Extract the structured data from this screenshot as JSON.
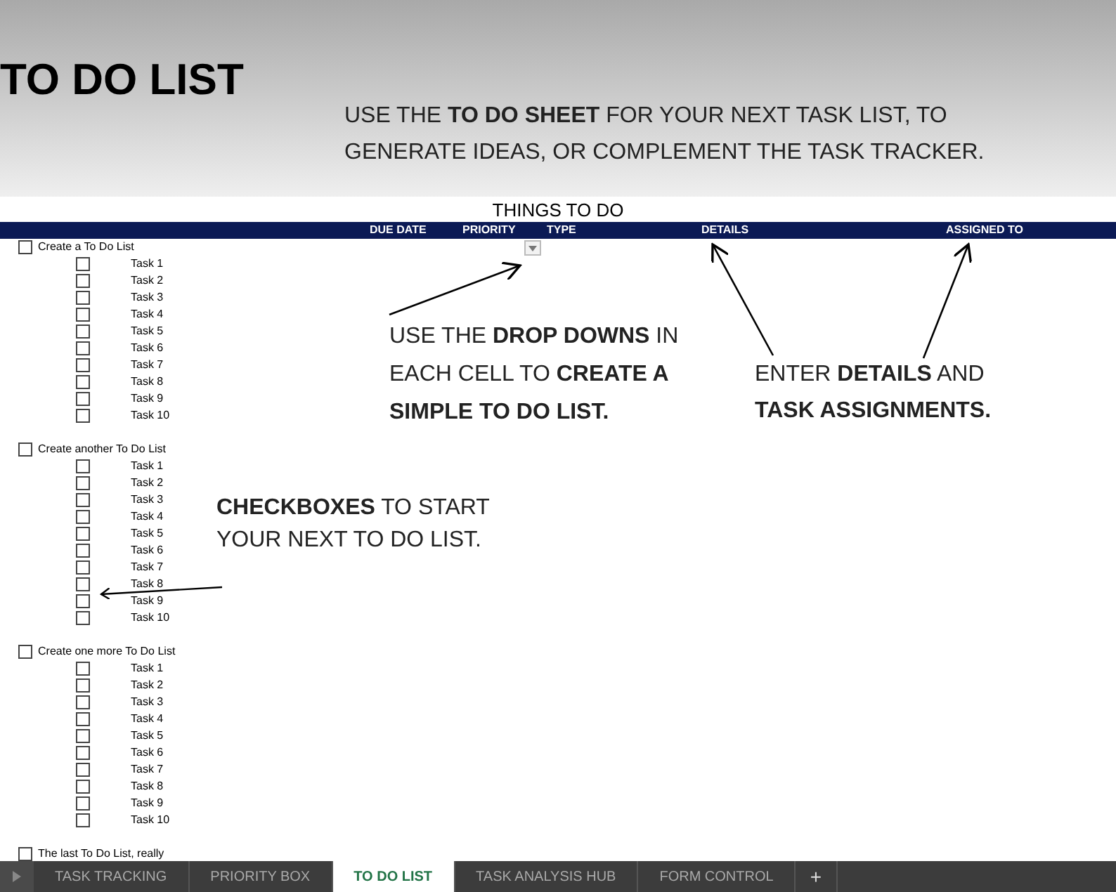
{
  "title": "TO DO LIST",
  "intro": [
    "USE THE **TO DO SHEET** FOR YOUR NEXT TASK LIST, TO",
    "GENERATE IDEAS, OR COMPLEMENT THE TASK TRACKER."
  ],
  "sheet": {
    "heading": "THINGS TO DO",
    "columns": [
      "DUE DATE",
      "PRIORITY",
      "TYPE",
      "DETAILS",
      "ASSIGNED TO"
    ],
    "lists": [
      {
        "label": "Create a To Do List",
        "checked": false,
        "tasks": [
          {
            "label": "Task 1",
            "checked": false
          },
          {
            "label": "Task 2",
            "checked": false
          },
          {
            "label": "Task 3",
            "checked": false
          },
          {
            "label": "Task 4",
            "checked": false
          },
          {
            "label": "Task 5",
            "checked": false
          },
          {
            "label": "Task 6",
            "checked": false
          },
          {
            "label": "Task 7",
            "checked": false
          },
          {
            "label": "Task 8",
            "checked": false
          },
          {
            "label": "Task 9",
            "checked": false
          },
          {
            "label": "Task 10",
            "checked": false
          }
        ]
      },
      {
        "label": "Create another To Do List",
        "checked": false,
        "tasks": [
          {
            "label": "Task 1",
            "checked": false
          },
          {
            "label": "Task 2",
            "checked": false
          },
          {
            "label": "Task 3",
            "checked": false
          },
          {
            "label": "Task 4",
            "checked": false
          },
          {
            "label": "Task 5",
            "checked": false
          },
          {
            "label": "Task 6",
            "checked": false
          },
          {
            "label": "Task 7",
            "checked": false
          },
          {
            "label": "Task 8",
            "checked": false
          },
          {
            "label": "Task 9",
            "checked": false
          },
          {
            "label": "Task 10",
            "checked": false
          }
        ]
      },
      {
        "label": "Create one more To Do List",
        "checked": false,
        "tasks": [
          {
            "label": "Task 1",
            "checked": false
          },
          {
            "label": "Task 2",
            "checked": false
          },
          {
            "label": "Task 3",
            "checked": false
          },
          {
            "label": "Task 4",
            "checked": false
          },
          {
            "label": "Task 5",
            "checked": false
          },
          {
            "label": "Task 6",
            "checked": false
          },
          {
            "label": "Task 7",
            "checked": false
          },
          {
            "label": "Task 8",
            "checked": false
          },
          {
            "label": "Task 9",
            "checked": false
          },
          {
            "label": "Task 10",
            "checked": false
          }
        ]
      },
      {
        "label": "The last To Do List, really",
        "checked": false
      }
    ]
  },
  "callouts": [
    {
      "lines": [
        "USE THE **DROP DOWNS** IN",
        "EACH CELL TO **CREATE A**",
        "**SIMPLE TO DO LIST.**"
      ]
    },
    {
      "lines": [
        "ENTER **DETAILS** AND",
        "**TASK ASSIGNMENTS.**"
      ]
    },
    {
      "lines": [
        "**CHECKBOXES** TO START",
        "YOUR NEXT TO DO LIST."
      ]
    }
  ],
  "sheet_tabs": [
    {
      "label": "TASK TRACKING",
      "selected": false
    },
    {
      "label": "PRIORITY BOX",
      "selected": false
    },
    {
      "label": "TO DO LIST",
      "selected": true
    },
    {
      "label": "TASK ANALYSIS HUB",
      "selected": false
    },
    {
      "label": "FORM CONTROL",
      "selected": false
    }
  ],
  "add_tab": "+"
}
